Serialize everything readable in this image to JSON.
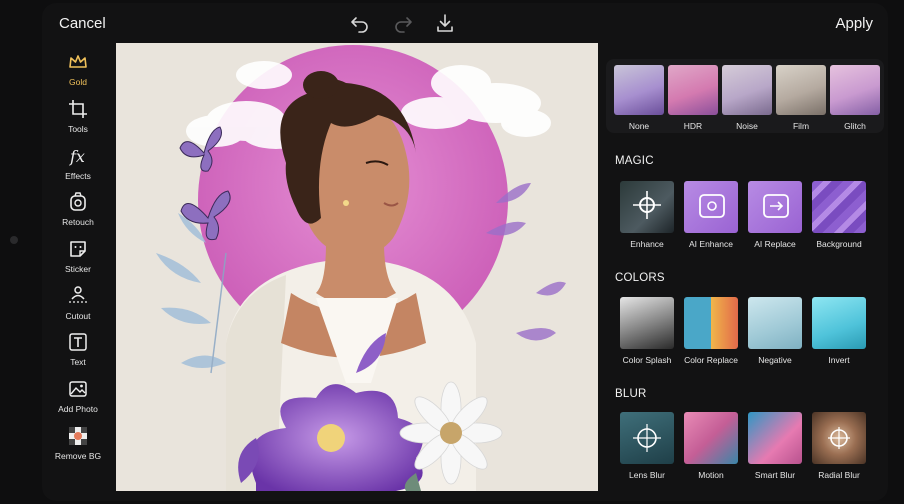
{
  "topbar": {
    "cancel_label": "Cancel",
    "apply_label": "Apply",
    "undo_icon": "undo-icon",
    "redo_icon": "redo-icon",
    "download_icon": "download-icon"
  },
  "tools": [
    {
      "label": "Gold",
      "icon": "crown-icon",
      "color": "#f0c15b"
    },
    {
      "label": "Tools",
      "icon": "crop-icon"
    },
    {
      "label": "Effects",
      "icon": "fx-icon"
    },
    {
      "label": "Retouch",
      "icon": "retouch-icon"
    },
    {
      "label": "Sticker",
      "icon": "sticker-icon"
    },
    {
      "label": "Cutout",
      "icon": "cutout-icon"
    },
    {
      "label": "Text",
      "icon": "text-icon"
    },
    {
      "label": "Add Photo",
      "icon": "add-photo-icon"
    },
    {
      "label": "Remove BG",
      "icon": "remove-bg-icon"
    }
  ],
  "filters": [
    "None",
    "HDR",
    "Noise",
    "Film",
    "Glitch"
  ],
  "sections": {
    "magic": {
      "title": "MAGIC",
      "items": [
        "Enhance",
        "AI Enhance",
        "AI Replace",
        "Background"
      ]
    },
    "colors": {
      "title": "COLORS",
      "items": [
        "Color Splash",
        "Color Replace",
        "Negative",
        "Invert"
      ]
    },
    "blur": {
      "title": "BLUR",
      "items": [
        "Lens Blur",
        "Motion",
        "Smart Blur",
        "Radial Blur"
      ]
    }
  },
  "colors": {
    "accent_gold": "#f0c15b",
    "magic_purple": "#a36bd8",
    "pink_circle": "#d96fc4"
  }
}
